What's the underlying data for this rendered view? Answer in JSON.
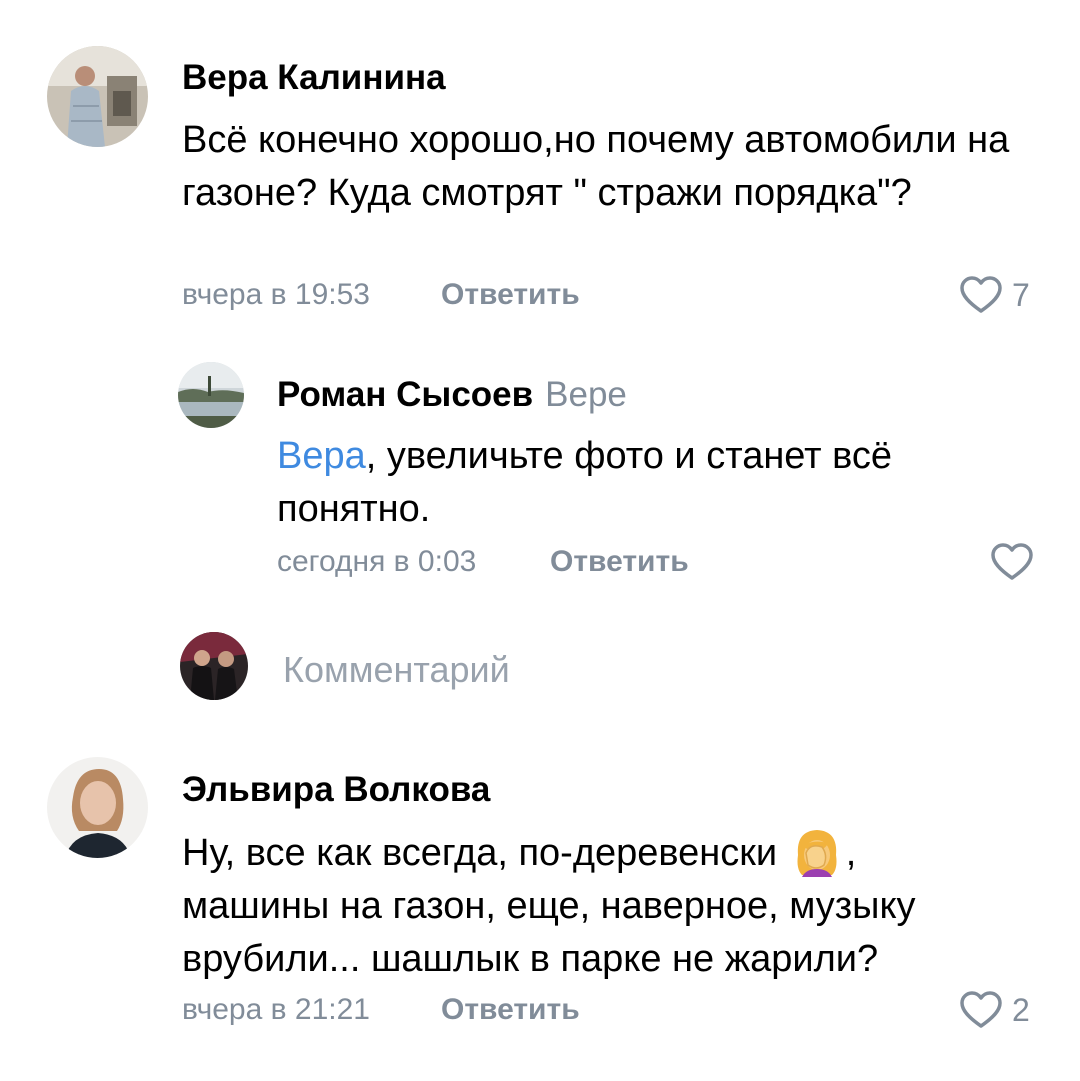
{
  "comments": [
    {
      "author": "Вера Калинина",
      "text": "Всё конечно хорошо,но почему автомобили на газоне? Куда смотрят \" стражи порядка\"?",
      "time": "вчера в 19:53",
      "reply_label": "Ответить",
      "likes": "7"
    },
    {
      "author": "Роман Сысоев",
      "reply_to": "Вере",
      "mention": "Вера",
      "text": ", увеличьте фото и станет всё понятно.",
      "time": "сегодня в 0:03",
      "reply_label": "Ответить",
      "likes": ""
    },
    {
      "author": "Эльвира Волкова",
      "text_part1": "Ну, все как всегда, по-деревенски",
      "text_part2": ", машины на газон, еще, наверное, музыку врубили... шашлык в парке не жарили?",
      "time": "вчера в 21:21",
      "reply_label": "Ответить",
      "likes": "2"
    }
  ],
  "reply_box": {
    "placeholder": "Комментарий"
  },
  "colors": {
    "secondary_text": "#818c99",
    "mention": "#3f8ae0",
    "placeholder": "#99a2ad"
  },
  "icons": {
    "like": "heart-outline-icon",
    "facepalm": "woman-facepalming-emoji"
  }
}
